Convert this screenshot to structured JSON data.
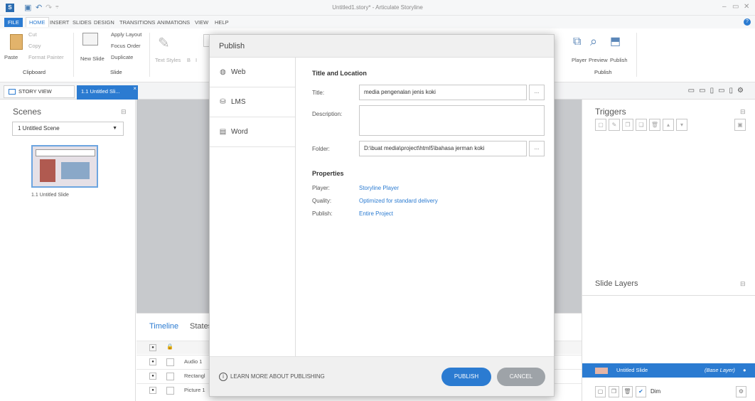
{
  "window": {
    "title": "Untitled1.story* - Articulate Storyline",
    "app_logo": "S"
  },
  "ribbon_tabs": [
    "FILE",
    "HOME",
    "INSERT",
    "SLIDES",
    "DESIGN",
    "TRANSITIONS",
    "ANIMATIONS",
    "VIEW",
    "HELP"
  ],
  "ribbon": {
    "clipboard": {
      "paste": "Paste",
      "cut": "Cut",
      "copy": "Copy",
      "format_painter": "Format Painter",
      "label": "Clipboard"
    },
    "slide": {
      "new_slide": "New Slide",
      "apply_layout": "Apply Layout",
      "focus_order": "Focus Order",
      "duplicate": "Duplicate",
      "label": "Slide"
    },
    "text": {
      "text_styles": "Text Styles",
      "bold": "B",
      "italic": "I"
    },
    "publish": {
      "player": "Player",
      "preview": "Preview",
      "publish": "Publish",
      "label": "Publish"
    }
  },
  "panel_tabs": {
    "story_view": "STORY VIEW",
    "slide_tab": "1.1 Untitled Sli..."
  },
  "scenes": {
    "title": "Scenes",
    "selected": "1 Untitled Scene",
    "slide_label": "1.1 Untitled Slide"
  },
  "timeline": {
    "tabs": [
      "Timeline",
      "States"
    ],
    "rows": [
      "Audio 1",
      "Rectangl",
      "Picture 1"
    ]
  },
  "triggers": {
    "title": "Triggers"
  },
  "slide_layers": {
    "title": "Slide Layers",
    "base_layer": "Untitled Slide",
    "base_layer_tag": "(Base Layer)",
    "dim_label": "Dim"
  },
  "dialog": {
    "title": "Publish",
    "nav": [
      {
        "label": "Web",
        "icon": "globe-icon"
      },
      {
        "label": "LMS",
        "icon": "database-icon"
      },
      {
        "label": "Word",
        "icon": "word-doc-icon"
      }
    ],
    "title_location": {
      "heading": "Title and Location",
      "title_label": "Title:",
      "title_value": "media pengenalan jenis koki",
      "description_label": "Description:",
      "description_value": "",
      "folder_label": "Folder:",
      "folder_value": "D:\\buat media\\project\\html5\\bahasa jerman koki",
      "browse": "..."
    },
    "properties": {
      "heading": "Properties",
      "player_label": "Player:",
      "player_value": "Storyline Player",
      "quality_label": "Quality:",
      "quality_value": "Optimized for standard delivery",
      "publish_label": "Publish:",
      "publish_value": "Entire Project"
    },
    "footer": {
      "learn_more": "LEARN MORE ABOUT PUBLISHING",
      "publish_button": "PUBLISH",
      "cancel_button": "CANCEL"
    }
  },
  "colors": {
    "accent": "#2b7bd1",
    "stage": "#c7c9cc",
    "cancel": "#9ea3a8"
  }
}
